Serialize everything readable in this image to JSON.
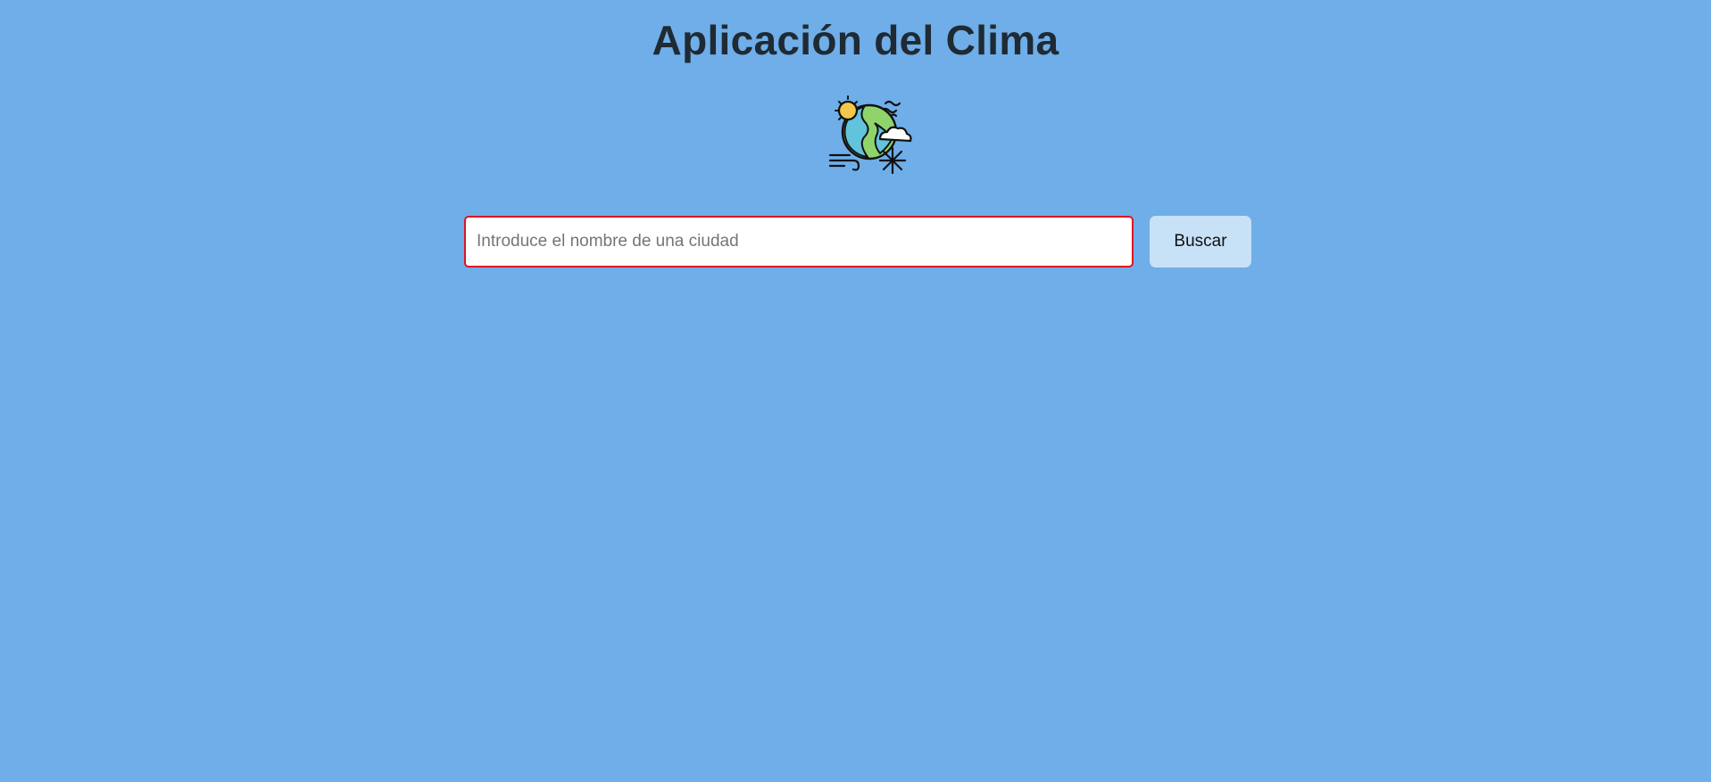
{
  "app": {
    "title": "Aplicación del Clima"
  },
  "logo": {
    "icon": "globe-weather-icon"
  },
  "search": {
    "placeholder": "Introduce el nombre de una ciudad",
    "value": "",
    "button_label": "Buscar"
  },
  "colors": {
    "background": "#6faee8",
    "input_border": "#e0141e",
    "button_bg": "#c7e1f7",
    "title_text": "#1f2a33"
  }
}
